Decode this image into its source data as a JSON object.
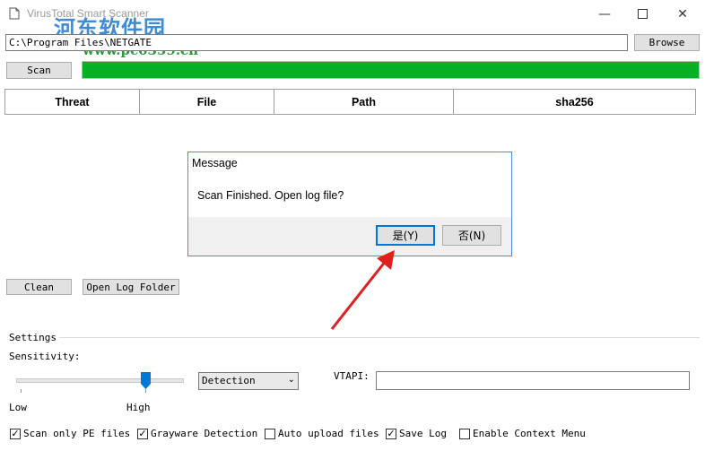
{
  "window": {
    "title": "VirusTotal Smart Scanner"
  },
  "watermark": {
    "cn": "河东软件园",
    "url": "www.pc0359.cn"
  },
  "toolbar": {
    "path_value": "C:\\Program Files\\NETGATE",
    "browse_label": "Browse",
    "scan_label": "Scan",
    "progress_percent": 100,
    "progress_color": "#06b025"
  },
  "table": {
    "columns": [
      "Threat",
      "File",
      "Path",
      "sha256"
    ]
  },
  "dialog": {
    "title": "Message",
    "message": "Scan Finished. Open log file?",
    "yes_label": "是(Y)",
    "no_label": "否(N)"
  },
  "actions": {
    "clean_label": "Clean",
    "open_log_folder_label": "Open Log Folder"
  },
  "settings": {
    "group_label": "Settings",
    "sensitivity_label": "Sensitivity:",
    "low_label": "Low",
    "high_label": "High",
    "sensitivity_value": "High",
    "mode_value": "Detection",
    "vtapi_label": "VTAPI:",
    "vtapi_value": ""
  },
  "options": [
    {
      "label": "Scan only PE files",
      "checked": true
    },
    {
      "label": "Grayware Detection",
      "checked": true
    },
    {
      "label": "Auto upload files",
      "checked": false
    },
    {
      "label": "Save Log",
      "checked": true
    },
    {
      "label": "Enable Context Menu",
      "checked": false
    }
  ],
  "colors": {
    "accent": "#0078d7",
    "arrow": "#e02020"
  }
}
